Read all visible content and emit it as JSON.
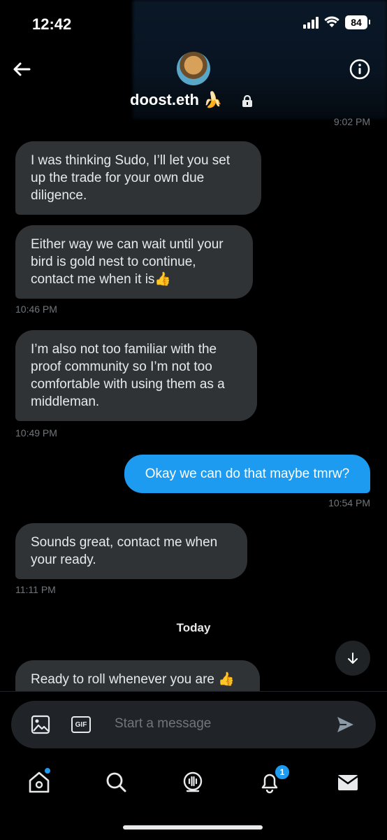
{
  "status_bar": {
    "time": "12:42",
    "battery": "84"
  },
  "header": {
    "contact_name": "doost.eth 🍌",
    "top_timestamp": "9:02 PM"
  },
  "messages": [
    {
      "direction": "received",
      "text": "I was thinking Sudo, I’ll let you set up the trade for your own due diligence.",
      "timestamp": ""
    },
    {
      "direction": "received",
      "text": "Either way we can wait until your bird is gold nest to continue, contact me when it is👍",
      "timestamp": "10:46 PM"
    },
    {
      "direction": "received",
      "text": "I’m also not too familiar with the proof community so I’m not too comfortable with using them as a middleman.",
      "timestamp": "10:49 PM"
    },
    {
      "direction": "sent",
      "text": "Okay we can do that maybe tmrw?",
      "timestamp": "10:54 PM"
    },
    {
      "direction": "received",
      "text": "Sounds great, contact me when your ready.",
      "timestamp": "11:11 PM"
    },
    {
      "direction": "received",
      "text": "Ready to roll whenever you are 👍",
      "timestamp": ""
    }
  ],
  "day_separator": "Today",
  "composer": {
    "placeholder": "Start a message",
    "gif_label": "GIF"
  },
  "tabbar": {
    "notifications_badge": "1"
  },
  "colors": {
    "accent": "#1d9bf0",
    "bubble_received": "#2f3336",
    "background": "#000000",
    "muted": "#71767b"
  }
}
